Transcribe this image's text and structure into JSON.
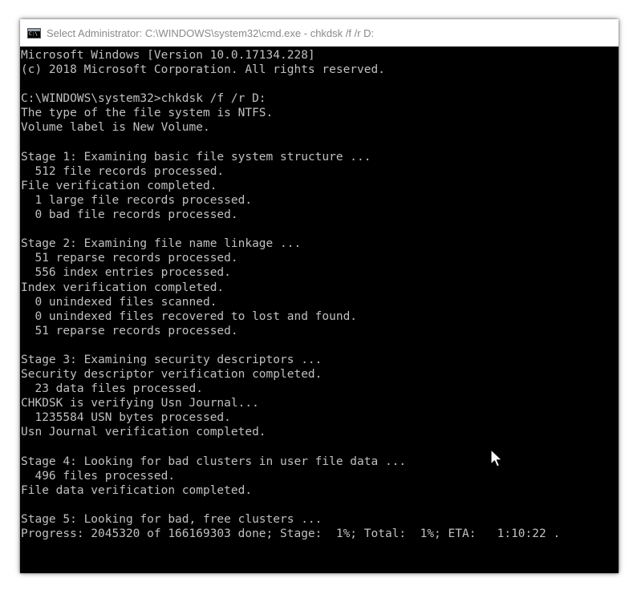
{
  "window": {
    "title": "Select Administrator: C:\\WINDOWS\\system32\\cmd.exe - chkdsk  /f /r D:",
    "app_icon": "cmd-icon"
  },
  "console": {
    "lines": [
      "Microsoft Windows [Version 10.0.17134.228]",
      "(c) 2018 Microsoft Corporation. All rights reserved.",
      "",
      "C:\\WINDOWS\\system32>chkdsk /f /r D:",
      "The type of the file system is NTFS.",
      "Volume label is New Volume.",
      "",
      "Stage 1: Examining basic file system structure ...",
      "  512 file records processed.",
      "File verification completed.",
      "  1 large file records processed.",
      "  0 bad file records processed.",
      "",
      "Stage 2: Examining file name linkage ...",
      "  51 reparse records processed.",
      "  556 index entries processed.",
      "Index verification completed.",
      "  0 unindexed files scanned.",
      "  0 unindexed files recovered to lost and found.",
      "  51 reparse records processed.",
      "",
      "Stage 3: Examining security descriptors ...",
      "Security descriptor verification completed.",
      "  23 data files processed.",
      "CHKDSK is verifying Usn Journal...",
      "  1235584 USN bytes processed.",
      "Usn Journal verification completed.",
      "",
      "Stage 4: Looking for bad clusters in user file data ...",
      "  496 files processed.",
      "File data verification completed.",
      "",
      "Stage 5: Looking for bad, free clusters ...",
      "Progress: 2045320 of 166169303 done; Stage:  1%; Total:  1%; ETA:   1:10:22 ."
    ]
  },
  "colors": {
    "console_bg": "#000000",
    "console_text": "#c0c0c0",
    "titlebar_bg": "#ffffff",
    "title_text": "#8a8a8a"
  }
}
